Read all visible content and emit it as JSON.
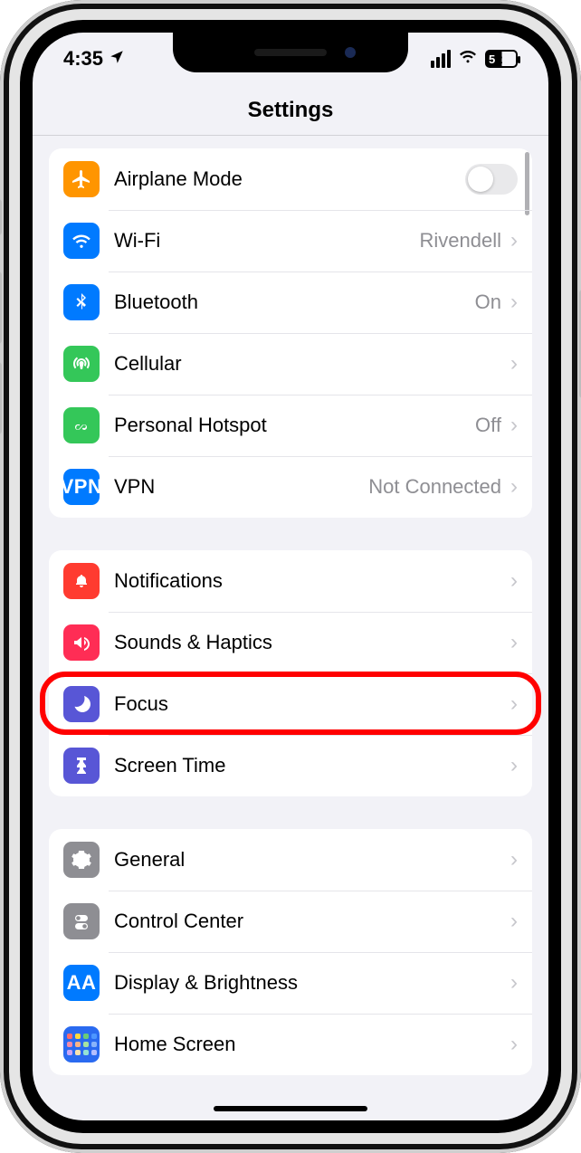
{
  "statusbar": {
    "time": "4:35",
    "battery_level": "52"
  },
  "navbar": {
    "title": "Settings"
  },
  "groups": [
    {
      "rows": [
        {
          "icon": "airplane",
          "label": "Airplane Mode",
          "detail": null,
          "accessory": "toggle-off"
        },
        {
          "icon": "wifi",
          "label": "Wi-Fi",
          "detail": "Rivendell",
          "accessory": "chevron"
        },
        {
          "icon": "bluetooth",
          "label": "Bluetooth",
          "detail": "On",
          "accessory": "chevron"
        },
        {
          "icon": "cellular",
          "label": "Cellular",
          "detail": null,
          "accessory": "chevron"
        },
        {
          "icon": "hotspot",
          "label": "Personal Hotspot",
          "detail": "Off",
          "accessory": "chevron"
        },
        {
          "icon": "vpn",
          "label": "VPN",
          "detail": "Not Connected",
          "accessory": "chevron"
        }
      ]
    },
    {
      "rows": [
        {
          "icon": "notifications",
          "label": "Notifications",
          "detail": null,
          "accessory": "chevron"
        },
        {
          "icon": "sounds",
          "label": "Sounds & Haptics",
          "detail": null,
          "accessory": "chevron"
        },
        {
          "icon": "focus",
          "label": "Focus",
          "detail": null,
          "accessory": "chevron",
          "highlighted": true
        },
        {
          "icon": "screentime",
          "label": "Screen Time",
          "detail": null,
          "accessory": "chevron"
        }
      ]
    },
    {
      "rows": [
        {
          "icon": "general",
          "label": "General",
          "detail": null,
          "accessory": "chevron"
        },
        {
          "icon": "controlcenter",
          "label": "Control Center",
          "detail": null,
          "accessory": "chevron"
        },
        {
          "icon": "display",
          "label": "Display & Brightness",
          "detail": null,
          "accessory": "chevron"
        },
        {
          "icon": "homescreen",
          "label": "Home Screen",
          "detail": null,
          "accessory": "chevron"
        }
      ]
    }
  ],
  "icon_text": {
    "vpn": "VPN",
    "display": "AA"
  }
}
